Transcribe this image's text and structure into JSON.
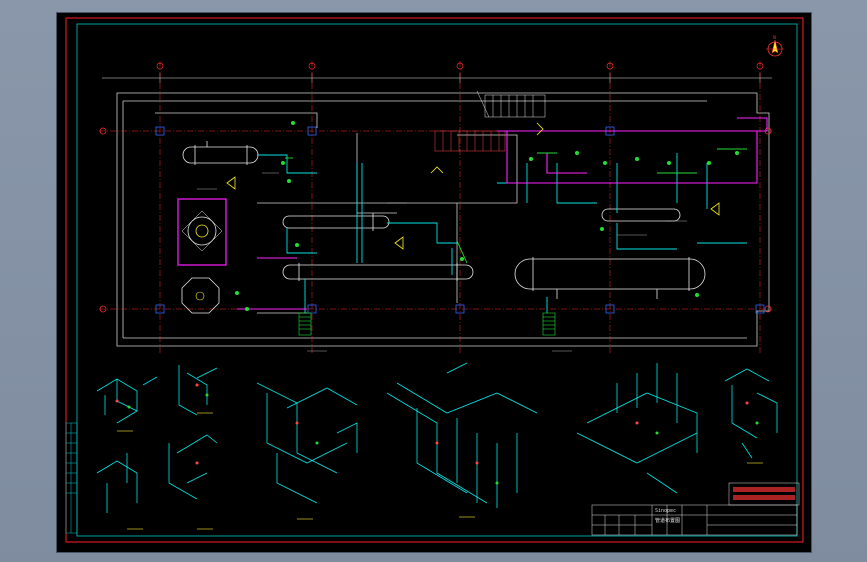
{
  "colors": {
    "viewport_background": "#8896a8",
    "sheet_background": "#000000",
    "frame_red": "#ff2020",
    "frame_inner": "#00c8c8",
    "grid_red": "#ff2a2a",
    "equipment_white": "#e8e8e8",
    "pipe_cyan": "#00e5e5",
    "pipe_green": "#22dd33",
    "pipe_magenta": "#ff22ff",
    "pipe_yellow": "#ffee22",
    "wall_grey": "#bfbfbf"
  },
  "icons": {
    "north_arrow": "north-arrow-icon"
  },
  "title_block": {
    "company": "Sinopec",
    "drawing_name": "管道布置图"
  }
}
